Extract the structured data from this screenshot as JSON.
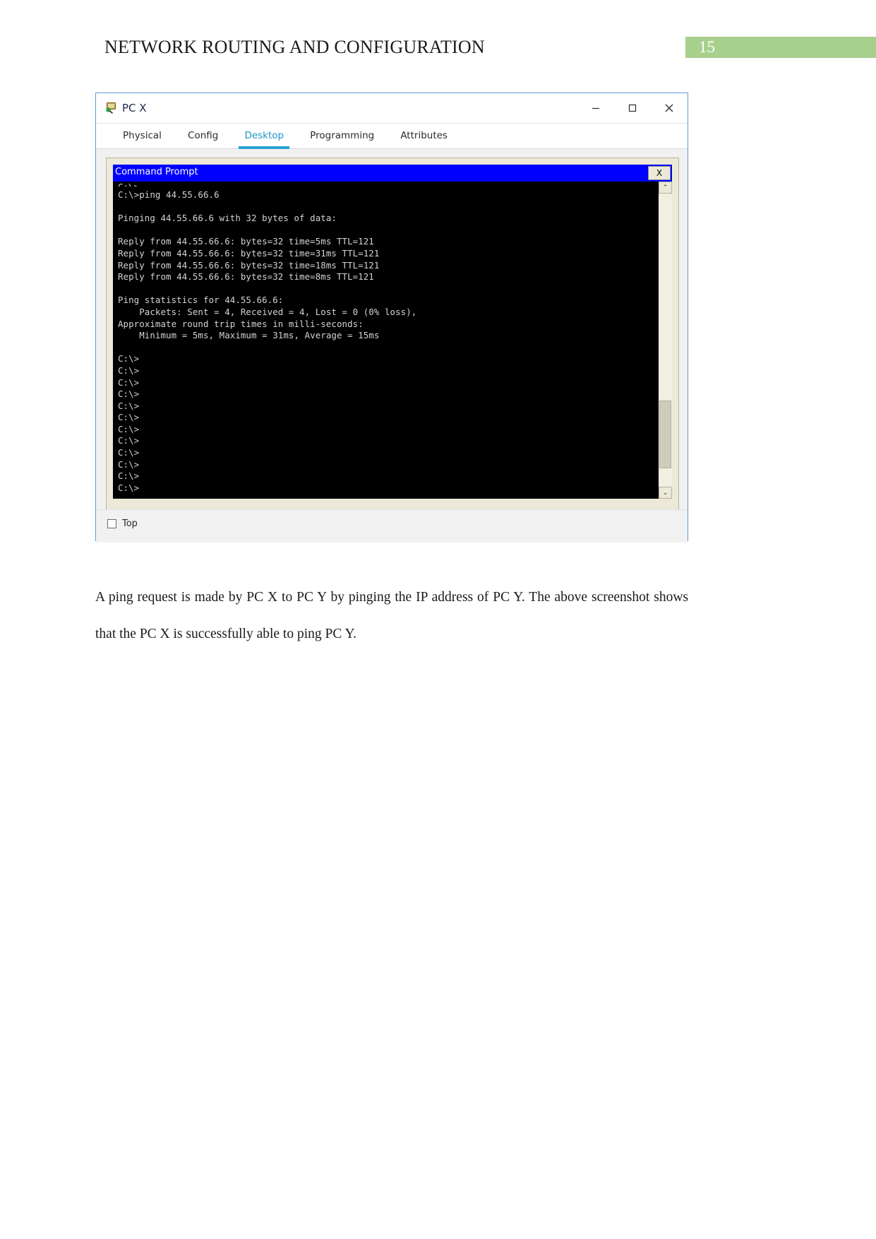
{
  "header": {
    "doc_title": "NETWORK ROUTING AND CONFIGURATION",
    "page_number": "15",
    "badge_color": "#a8d08d"
  },
  "window": {
    "title": "PC X",
    "icon": "pc-device-icon",
    "minimize_label": "—",
    "maximize_label": "□",
    "close_label": "×",
    "tabs": [
      {
        "label": "Physical",
        "active": false
      },
      {
        "label": "Config",
        "active": false
      },
      {
        "label": "Desktop",
        "active": true
      },
      {
        "label": "Programming",
        "active": false
      },
      {
        "label": "Attributes",
        "active": false
      }
    ],
    "active_tab_color": "#2196c4",
    "footer": {
      "checkbox_label": "Top",
      "checked": false
    }
  },
  "command_prompt": {
    "title": "Command Prompt",
    "titlebar_color": "#0000ff",
    "close_label": "X",
    "scrollbar": {
      "up_arrow": "⌃",
      "down_arrow": "⌄"
    },
    "partial_top_line": "C:\\>",
    "terminal_text": "C:\\>ping 44.55.66.6\n\nPinging 44.55.66.6 with 32 bytes of data:\n\nReply from 44.55.66.6: bytes=32 time=5ms TTL=121\nReply from 44.55.66.6: bytes=32 time=31ms TTL=121\nReply from 44.55.66.6: bytes=32 time=18ms TTL=121\nReply from 44.55.66.6: bytes=32 time=8ms TTL=121\n\nPing statistics for 44.55.66.6:\n    Packets: Sent = 4, Received = 4, Lost = 0 (0% loss),\nApproximate round trip times in milli-seconds:\n    Minimum = 5ms, Maximum = 31ms, Average = 15ms\n\nC:\\>\nC:\\>\nC:\\>\nC:\\>\nC:\\>\nC:\\>\nC:\\>\nC:\\>\nC:\\>\nC:\\>\nC:\\>\nC:\\>",
    "ping_target": "44.55.66.6",
    "packet_size": "32",
    "replies": [
      {
        "from": "44.55.66.6",
        "bytes": "32",
        "time": "5ms",
        "ttl": "121"
      },
      {
        "from": "44.55.66.6",
        "bytes": "32",
        "time": "31ms",
        "ttl": "121"
      },
      {
        "from": "44.55.66.6",
        "bytes": "32",
        "time": "18ms",
        "ttl": "121"
      },
      {
        "from": "44.55.66.6",
        "bytes": "32",
        "time": "8ms",
        "ttl": "121"
      }
    ],
    "statistics": {
      "sent": "4",
      "received": "4",
      "lost": "0",
      "loss_percent": "0%",
      "minimum": "5ms",
      "maximum": "31ms",
      "average": "15ms"
    }
  },
  "paragraph": {
    "text": "A ping request is made by PC X to PC Y by pinging the IP address of PC Y. The above screenshot shows that the PC X is successfully able to ping PC Y."
  }
}
